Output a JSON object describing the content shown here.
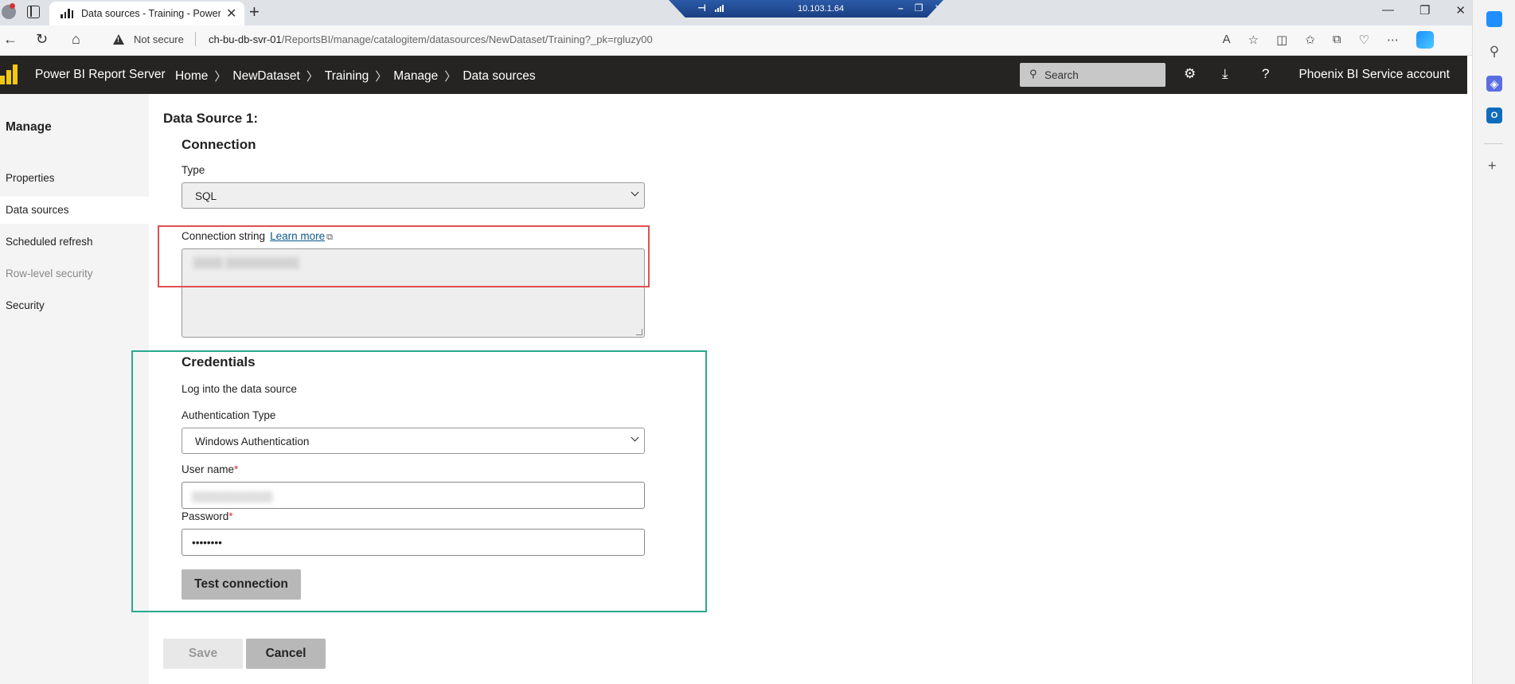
{
  "browser": {
    "tab_title": "Data sources - Training - Power BI Report Server",
    "url_prefix": "ch-bu-db-svr-01",
    "url_path": "/ReportsBI/manage/catalogitem/datasources/NewDataset/Training?_pk=rgluzy00",
    "not_secure": "Not secure",
    "rdp_ip": "10.103.1.64"
  },
  "header": {
    "brand": "Power BI Report Server",
    "breadcrumbs": [
      "Home",
      "NewDataset",
      "Training",
      "Manage",
      "Data sources"
    ],
    "search_placeholder": "Search",
    "account": "Phoenix BI Service account"
  },
  "sidebar": {
    "title": "Manage",
    "items": [
      {
        "label": "Properties",
        "state": "normal"
      },
      {
        "label": "Data sources",
        "state": "active"
      },
      {
        "label": "Scheduled refresh",
        "state": "normal"
      },
      {
        "label": "Row-level security",
        "state": "disabled"
      },
      {
        "label": "Security",
        "state": "normal"
      }
    ]
  },
  "form": {
    "datasource_title": "Data Source 1:",
    "connection": {
      "heading": "Connection",
      "type_label": "Type",
      "type_value": "SQL",
      "connstr_label": "Connection string",
      "learn_more": "Learn more"
    },
    "credentials": {
      "heading": "Credentials",
      "subtitle": "Log into the data source",
      "auth_label": "Authentication Type",
      "auth_value": "Windows Authentication",
      "username_label": "User name",
      "password_label": "Password",
      "password_value": "••••••••",
      "required_mark": "*",
      "test_button": "Test connection"
    },
    "save_button": "Save",
    "cancel_button": "Cancel"
  },
  "colors": {
    "header_bg": "#252423",
    "brand_yellow": "#f2c811",
    "annotation_red": "#e05050",
    "annotation_green": "#27a98e"
  }
}
